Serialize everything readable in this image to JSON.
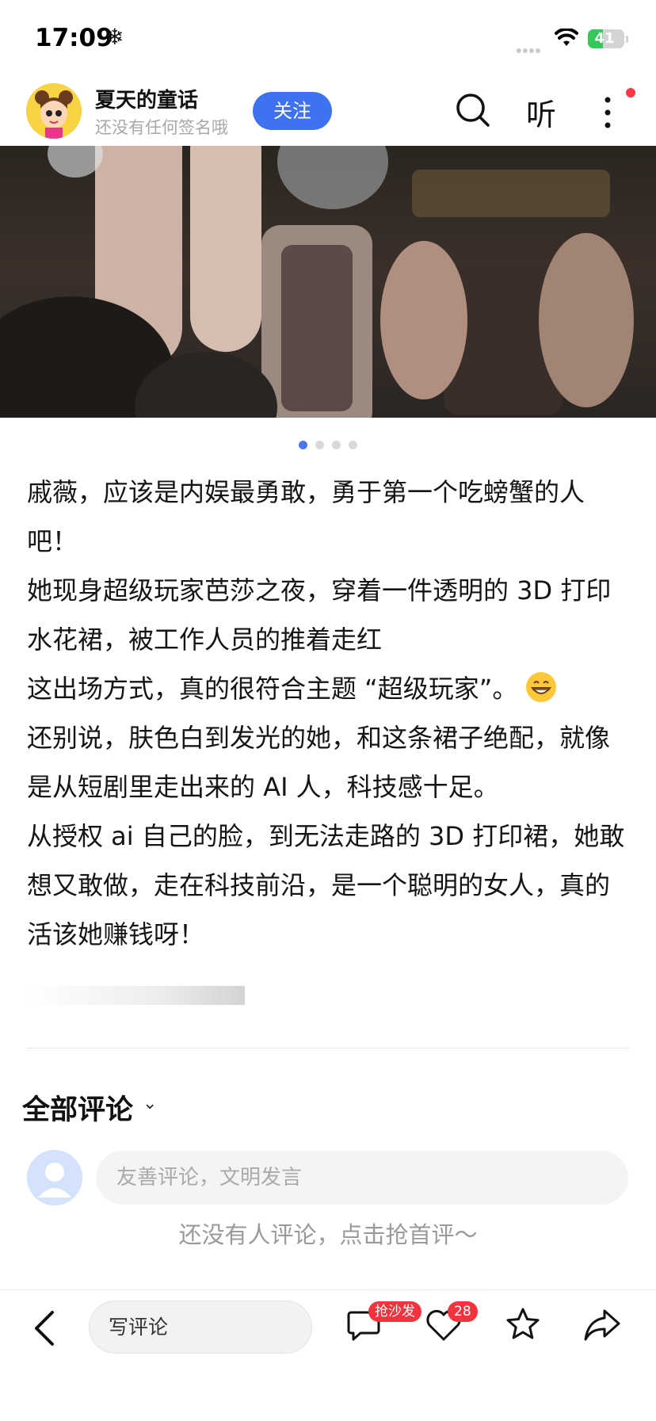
{
  "status_bar": {
    "time": "17:09",
    "snow_glyph": "❄",
    "battery_text": "41",
    "battery_level": 0.41
  },
  "header": {
    "author_name": "夏天的童话",
    "author_sign": "还没有任何签名哦",
    "follow_label": "关注",
    "listen_label": "听"
  },
  "carousel": {
    "count": 4,
    "active_index": 0
  },
  "article": {
    "p1": "戚薇，应该是内娱最勇敢，勇于第一个吃螃蟹的人吧！",
    "p2": "她现身超级玩家芭莎之夜，穿着一件透明的 3D 打印水花裙，被工作人员的推着走红",
    "p3": "这出场方式，真的很符合主题 “超级玩家”。",
    "p4": "还别说，肤色白到发光的她，和这条裙子绝配，就像是从短剧里走出来的 AI 人，科技感十足。",
    "p5": "从授权 ai 自己的脸，到无法走路的 3D 打印裙，她敢想又敢做，走在科技前沿，是一个聪明的女人，真的活该她赚钱呀！"
  },
  "comments": {
    "title": "全部评论",
    "input_placeholder": "友善评论，文明发言",
    "empty_text": "还没有人评论，点击抢首评～"
  },
  "bottom_bar": {
    "write_placeholder": "写评论",
    "sofa_badge": "抢沙发",
    "like_count": "28"
  },
  "colors": {
    "accent": "#3f72f0",
    "badge": "#f3343f",
    "battery": "#35c75a"
  }
}
